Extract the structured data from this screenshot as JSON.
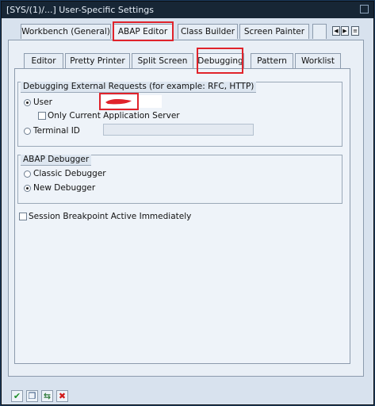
{
  "window": {
    "title": "[SYS/(1)/...] User-Specific Settings"
  },
  "top_tabs": [
    "Workbench (General)",
    "ABAP Editor",
    "Class Builder",
    "Screen Painter"
  ],
  "sub_tabs": [
    "Editor",
    "Pretty Printer",
    "Split Screen",
    "Debugging",
    "Pattern",
    "Worklist"
  ],
  "external": {
    "title": "Debugging External Requests (for example: RFC, HTTP)",
    "user_label": "User",
    "user_value": "",
    "only_current_label": "Only Current Application Server",
    "terminal_label": "Terminal ID",
    "terminal_value": ""
  },
  "debugger": {
    "title": "ABAP Debugger",
    "classic_label": "Classic Debugger",
    "new_label": "New Debugger"
  },
  "session_bp_label": "Session Breakpoint Active Immediately",
  "footer_icons": [
    "confirm-icon",
    "copy-icon",
    "transfer-icon",
    "cancel-icon"
  ],
  "colors": {
    "title_bar": "#172635",
    "panel": "#eef3f9",
    "highlight": "#e0232b",
    "confirm": "#1f8f2a",
    "cancel": "#d01818"
  }
}
